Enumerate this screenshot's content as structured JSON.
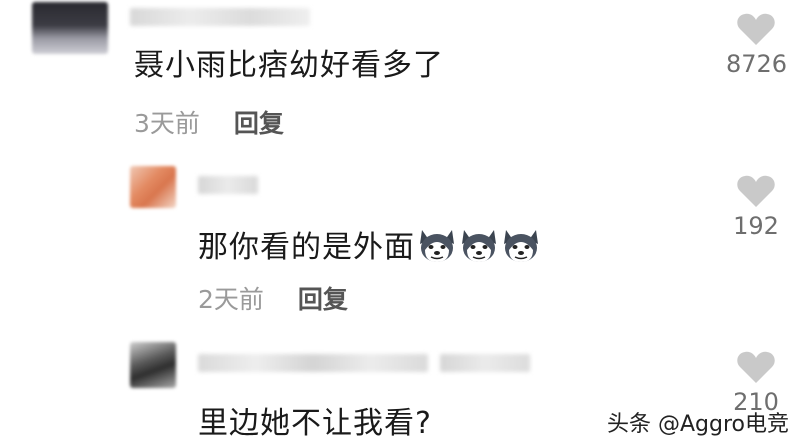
{
  "comments": [
    {
      "text": "聂小雨比痞幼好看多了",
      "time": "3天前",
      "reply_label": "回复",
      "likes": "8726"
    },
    {
      "text": "那你看的是外面",
      "emoji": "husky-dog-emoji",
      "emoji_count": 3,
      "time": "2天前",
      "reply_label": "回复",
      "likes": "192"
    },
    {
      "text": "里边她不让我看?",
      "likes": "210"
    }
  ],
  "watermark": "头条 @Aggro电竞",
  "colors": {
    "like_icon": "#c9c9c9",
    "time": "#9a9a9a",
    "reply": "#555555"
  }
}
